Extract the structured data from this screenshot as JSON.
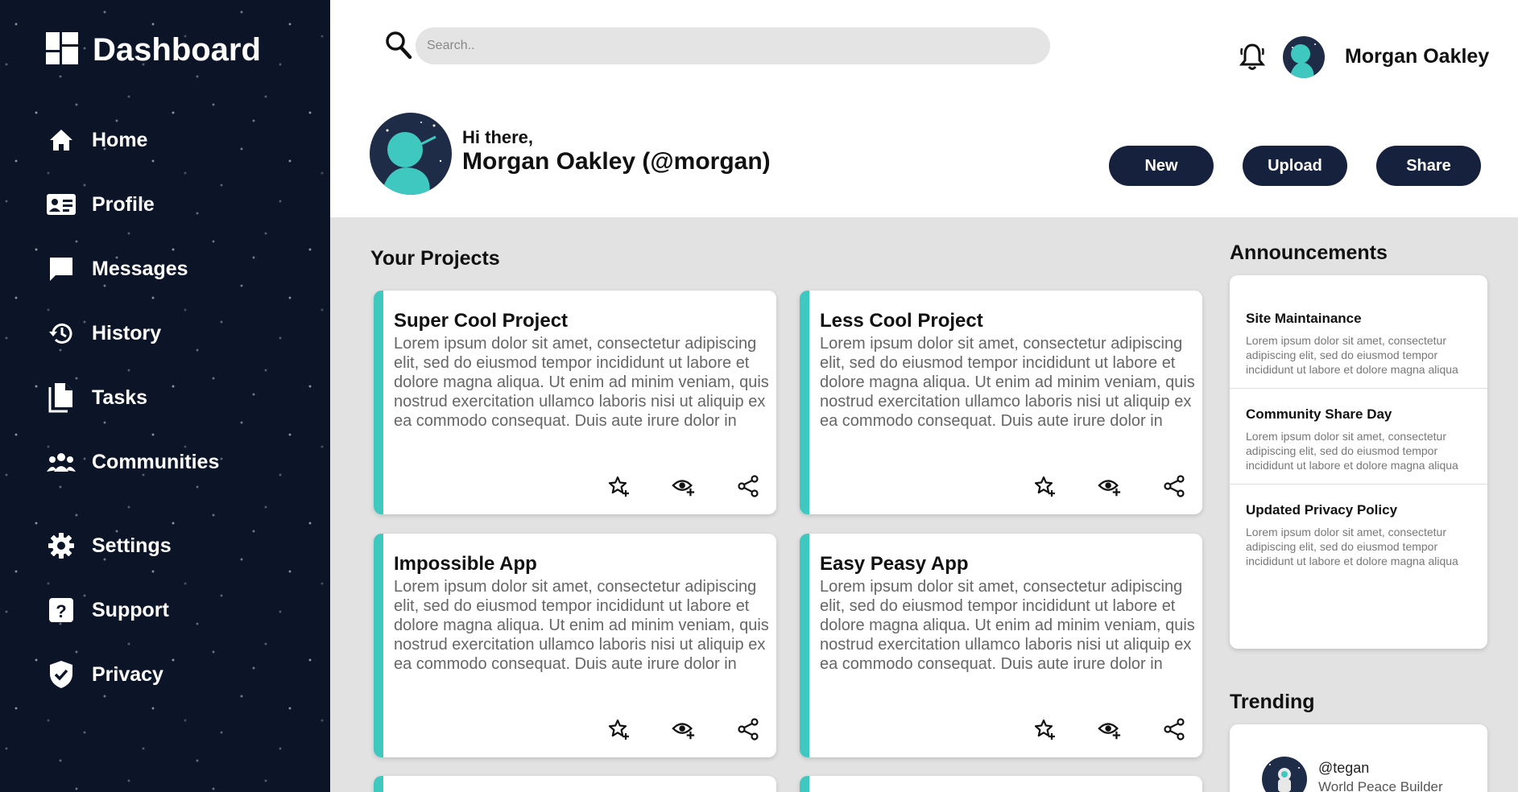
{
  "sidebar": {
    "title": "Dashboard",
    "items": [
      {
        "label": "Home",
        "icon": "home-icon"
      },
      {
        "label": "Profile",
        "icon": "id-card-icon"
      },
      {
        "label": "Messages",
        "icon": "message-icon"
      },
      {
        "label": "History",
        "icon": "history-icon"
      },
      {
        "label": "Tasks",
        "icon": "document-icon"
      },
      {
        "label": "Communities",
        "icon": "people-icon"
      },
      {
        "label": "Settings",
        "icon": "gear-icon"
      },
      {
        "label": "Support",
        "icon": "help-icon"
      },
      {
        "label": "Privacy",
        "icon": "shield-check-icon"
      }
    ]
  },
  "header": {
    "search_placeholder": "Search..",
    "user_name": "Morgan Oakley",
    "greeting": "Hi there,",
    "greeting_name": "Morgan Oakley (@morgan)",
    "buttons": {
      "new": "New",
      "upload": "Upload",
      "share": "Share"
    }
  },
  "projects": {
    "title": "Your Projects",
    "items": [
      {
        "title": "Super Cool Project",
        "body": "Lorem ipsum dolor sit amet, consectetur adipiscing elit, sed do eiusmod tempor incididunt ut labore et dolore magna aliqua. Ut enim ad minim veniam, quis nostrud exercitation ullamco laboris nisi ut aliquip ex ea commodo consequat. Duis aute irure dolor in"
      },
      {
        "title": "Less Cool Project",
        "body": "Lorem ipsum dolor sit amet, consectetur adipiscing elit, sed do eiusmod tempor incididunt ut labore et dolore magna aliqua. Ut enim ad minim veniam, quis nostrud exercitation ullamco laboris nisi ut aliquip ex ea commodo consequat. Duis aute irure dolor in"
      },
      {
        "title": "Impossible App",
        "body": "Lorem ipsum dolor sit amet, consectetur adipiscing elit, sed do eiusmod tempor incididunt ut labore et dolore magna aliqua. Ut enim ad minim veniam, quis nostrud exercitation ullamco laboris nisi ut aliquip ex ea commodo consequat. Duis aute irure dolor in"
      },
      {
        "title": "Easy Peasy App",
        "body": "Lorem ipsum dolor sit amet, consectetur adipiscing elit, sed do eiusmod tempor incididunt ut labore et dolore magna aliqua. Ut enim ad minim veniam, quis nostrud exercitation ullamco laboris nisi ut aliquip ex ea commodo consequat. Duis aute irure dolor in"
      }
    ]
  },
  "announcements": {
    "title": "Announcements",
    "items": [
      {
        "title": "Site Maintainance",
        "body": "Lorem ipsum dolor sit amet, consectetur adipiscing elit, sed do eiusmod tempor incididunt ut labore et dolore magna aliqua"
      },
      {
        "title": "Community Share Day",
        "body": "Lorem ipsum dolor sit amet, consectetur adipiscing elit, sed do eiusmod tempor incididunt ut labore et dolore magna aliqua"
      },
      {
        "title": "Updated Privacy Policy",
        "body": "Lorem ipsum dolor sit amet, consectetur adipiscing elit, sed do eiusmod tempor incididunt ut labore et dolore magna aliqua"
      }
    ]
  },
  "trending": {
    "title": "Trending",
    "items": [
      {
        "handle": "@tegan",
        "subtitle": "World Peace Builder"
      }
    ]
  },
  "colors": {
    "sidebar_bg": "#0c1528",
    "accent": "#3fc8c0",
    "button_bg": "#16213d",
    "main_bg": "#e2e2e2"
  }
}
